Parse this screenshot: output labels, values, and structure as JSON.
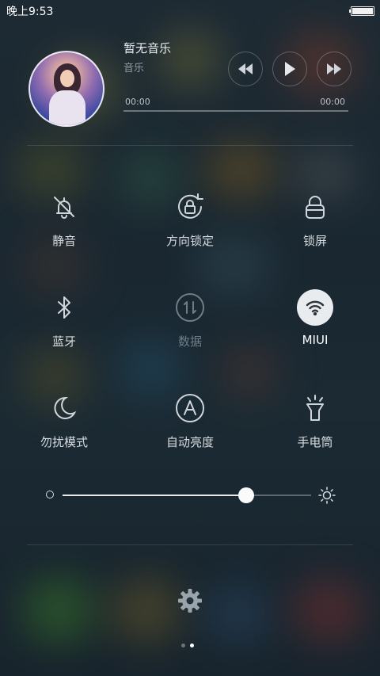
{
  "status_bar": {
    "time": "晚上9:53"
  },
  "media": {
    "title": "暂无音乐",
    "subtitle": "音乐",
    "time_start": "00:00",
    "time_end": "00:00",
    "progress": 0
  },
  "toggles": [
    {
      "label": "静音",
      "icon": "bell-off-icon",
      "state": "off"
    },
    {
      "label": "方向锁定",
      "icon": "rotation-lock-icon",
      "state": "off"
    },
    {
      "label": "锁屏",
      "icon": "lock-icon",
      "state": "off"
    },
    {
      "label": "蓝牙",
      "icon": "bluetooth-icon",
      "state": "off"
    },
    {
      "label": "数据",
      "icon": "data-icon",
      "state": "disabled"
    },
    {
      "label": "MIUI",
      "icon": "wifi-icon",
      "state": "on"
    },
    {
      "label": "勿扰模式",
      "icon": "moon-icon",
      "state": "off"
    },
    {
      "label": "自动亮度",
      "icon": "auto-brightness-icon",
      "state": "off"
    },
    {
      "label": "手电筒",
      "icon": "flashlight-icon",
      "state": "off"
    }
  ],
  "brightness": {
    "level": 0.74
  },
  "page_indicator": {
    "count": 2,
    "active": 1
  },
  "colors": {
    "accent_on": "#e9ecef",
    "background": "#1b2630"
  }
}
